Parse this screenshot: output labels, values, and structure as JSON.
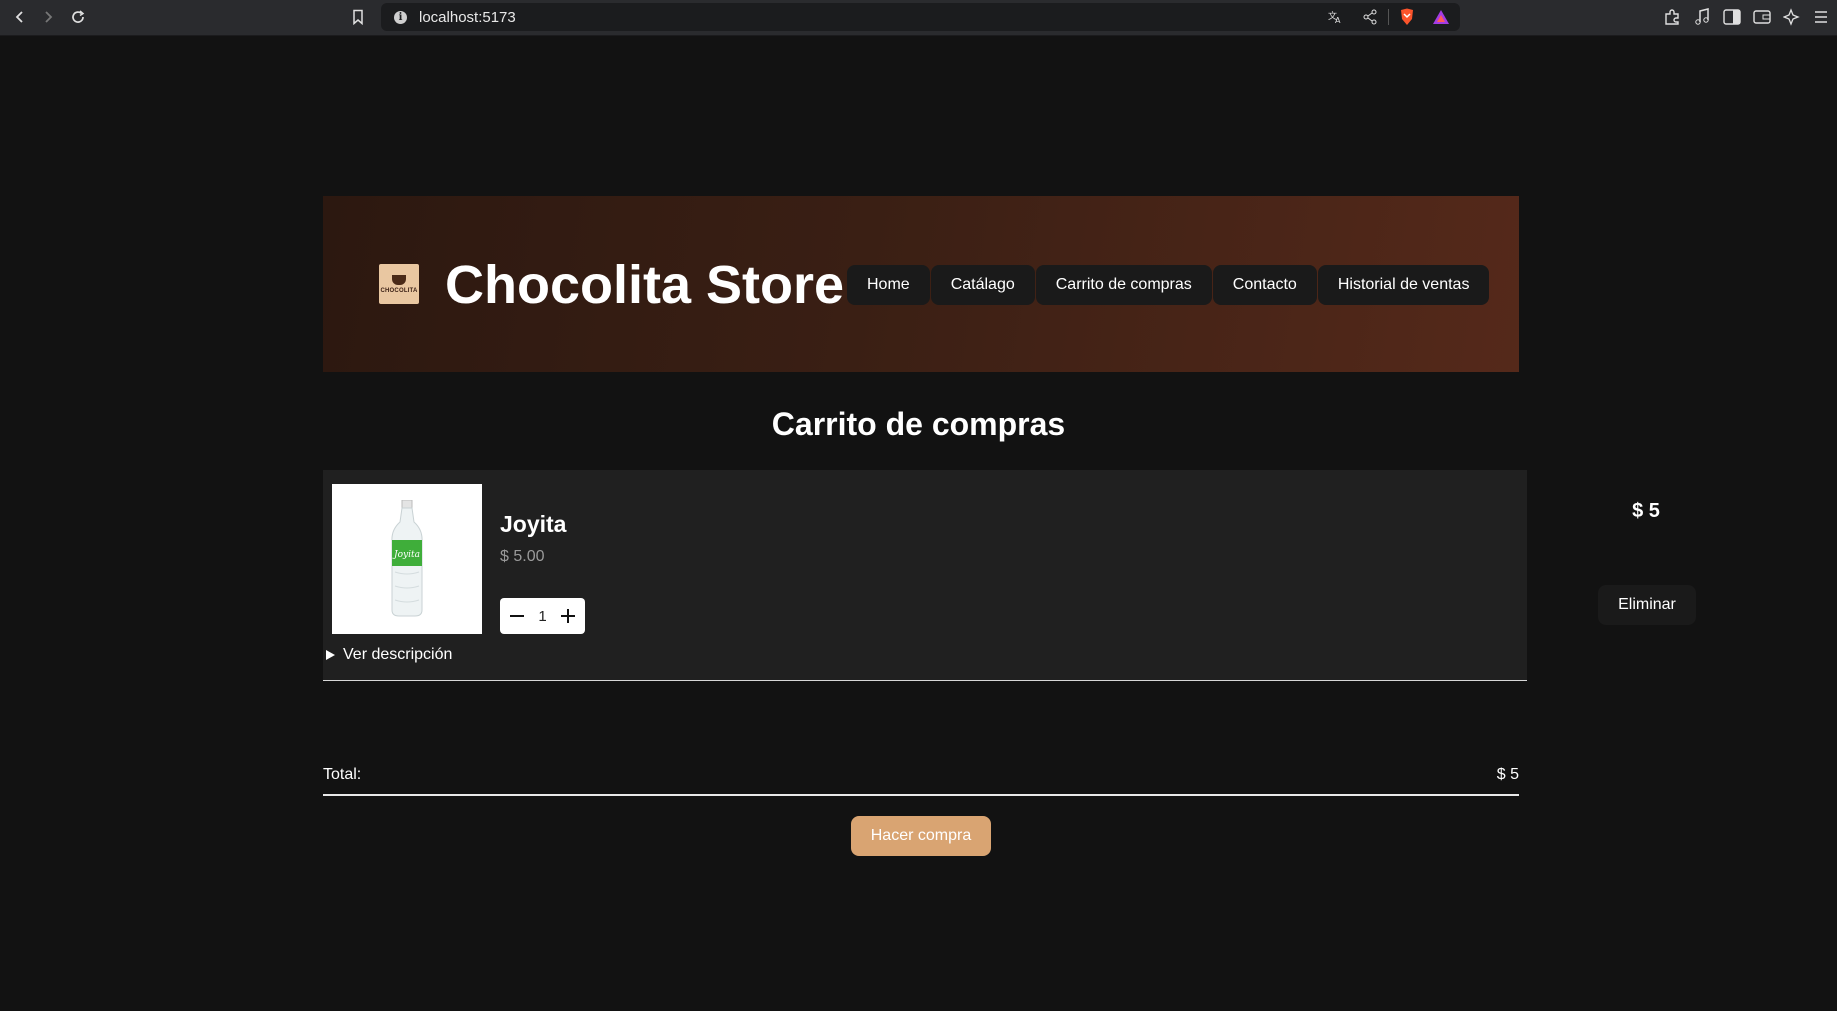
{
  "browser": {
    "url": "localhost:5173"
  },
  "header": {
    "logo_text": "CHOCOLITA",
    "title": "Chocolita Store",
    "nav": [
      {
        "label": "Home"
      },
      {
        "label": "Catálago"
      },
      {
        "label": "Carrito de compras"
      },
      {
        "label": "Contacto"
      },
      {
        "label": "Historial de ventas"
      }
    ]
  },
  "page": {
    "title": "Carrito de compras"
  },
  "cart": {
    "items": [
      {
        "name": "Joyita",
        "unit_price": "$ 5.00",
        "quantity": "1",
        "line_total": "$ 5",
        "remove_label": "Eliminar",
        "description_toggle": "Ver descripción"
      }
    ],
    "total_label": "Total:",
    "total_value": "$ 5",
    "checkout_label": "Hacer compra"
  },
  "colors": {
    "page_bg": "#121212",
    "accent": "#d9a472",
    "header_gradient_start": "#2c1810",
    "header_gradient_end": "#55291a"
  }
}
